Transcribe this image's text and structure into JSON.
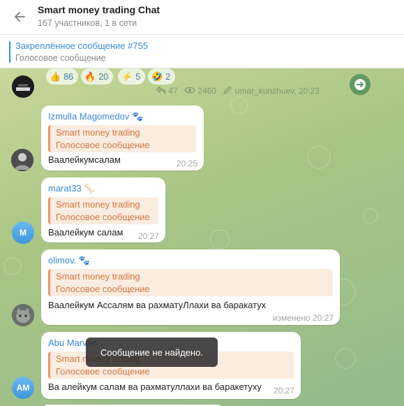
{
  "header": {
    "title": "Smart money trading Chat",
    "subtitle": "167 участников, 1 в сети"
  },
  "pinned": {
    "title": "Закреплённое сообщение #755",
    "text": "Голосовое сообщение"
  },
  "top_message": {
    "reactions": [
      {
        "emoji": "👍",
        "count": "86"
      },
      {
        "emoji": "🔥",
        "count": "20"
      },
      {
        "emoji": "⚡",
        "count": "5"
      },
      {
        "emoji": "🤣",
        "count": "2"
      }
    ],
    "forwards": "47",
    "views": "2460",
    "author_time": "umar_kunzhuev, 20:23"
  },
  "messages": [
    {
      "sender": "Izmulla Magomedov",
      "sender_emoji": "🐾",
      "quote_title": "Smart money trading",
      "quote_text": "Голосовое сообщение",
      "text": "Ваалейкумсалам",
      "time": "20:25",
      "avatar": ""
    },
    {
      "sender": "marat33",
      "sender_emoji": "🦴",
      "quote_title": "Smart money trading",
      "quote_text": "Голосовое сообщение",
      "text": "Ваалейкум салам",
      "time": "20:27",
      "avatar": "M"
    },
    {
      "sender": "olimov.",
      "sender_emoji": "🐾",
      "quote_title": "Smart money trading",
      "quote_text": "Голосовое сообщение",
      "text": "Ваалейкум Ассалям ва рахматуЛлахи ва баракатух",
      "time": "изменено 20:27",
      "avatar": ""
    },
    {
      "sender": "Abu Marvan",
      "sender_emoji": "",
      "quote_title": "Smart money trading",
      "quote_text": "Голосовое сообщение",
      "text": "Ва алейкум салам ва рахматуллахи ва баракетуху",
      "time": "20:27",
      "avatar": "AM"
    }
  ],
  "toast": "Сообщение не найдено.",
  "colors": {
    "accent": "#3a8bd6",
    "quote_accent": "#d2773f",
    "chat_bg": "#a9c584",
    "bubble": "#ffffff"
  }
}
